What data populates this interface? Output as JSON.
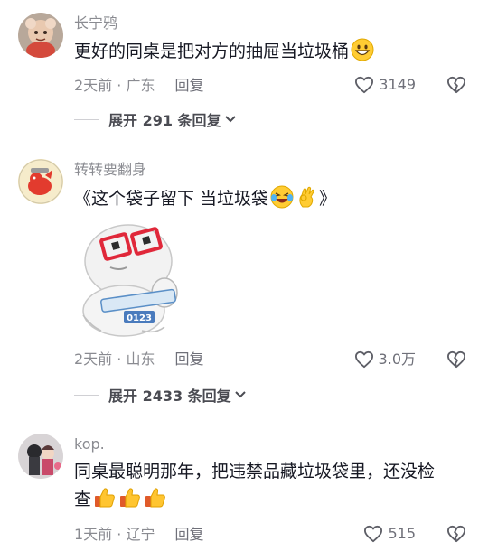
{
  "comments": [
    {
      "username": "长宁鸦",
      "text": "更好的同桌是把对方的抽屉当垃圾桶",
      "time": "2天前 · 广东",
      "reply_label": "回复",
      "likes": "3149",
      "expand_label": "展开 291 条回复"
    },
    {
      "username": "转转要翻身",
      "text": "《这个袋子留下 当垃圾袋",
      "text_end": "》",
      "time": "2天前 · 山东",
      "reply_label": "回复",
      "likes": "3.0万",
      "expand_label": "展开 2433 条回复",
      "sticker_text": "0123"
    },
    {
      "username": "kop.",
      "text_line1": "同桌最聪明那年，把违禁品藏垃圾袋里，还没检",
      "text_line2": "查",
      "time": "1天前 · 辽宁",
      "reply_label": "回复",
      "likes": "515"
    }
  ],
  "icons": {
    "like": "heart-outline-icon",
    "dislike": "broken-heart-icon",
    "expand": "chevron-down-icon"
  }
}
